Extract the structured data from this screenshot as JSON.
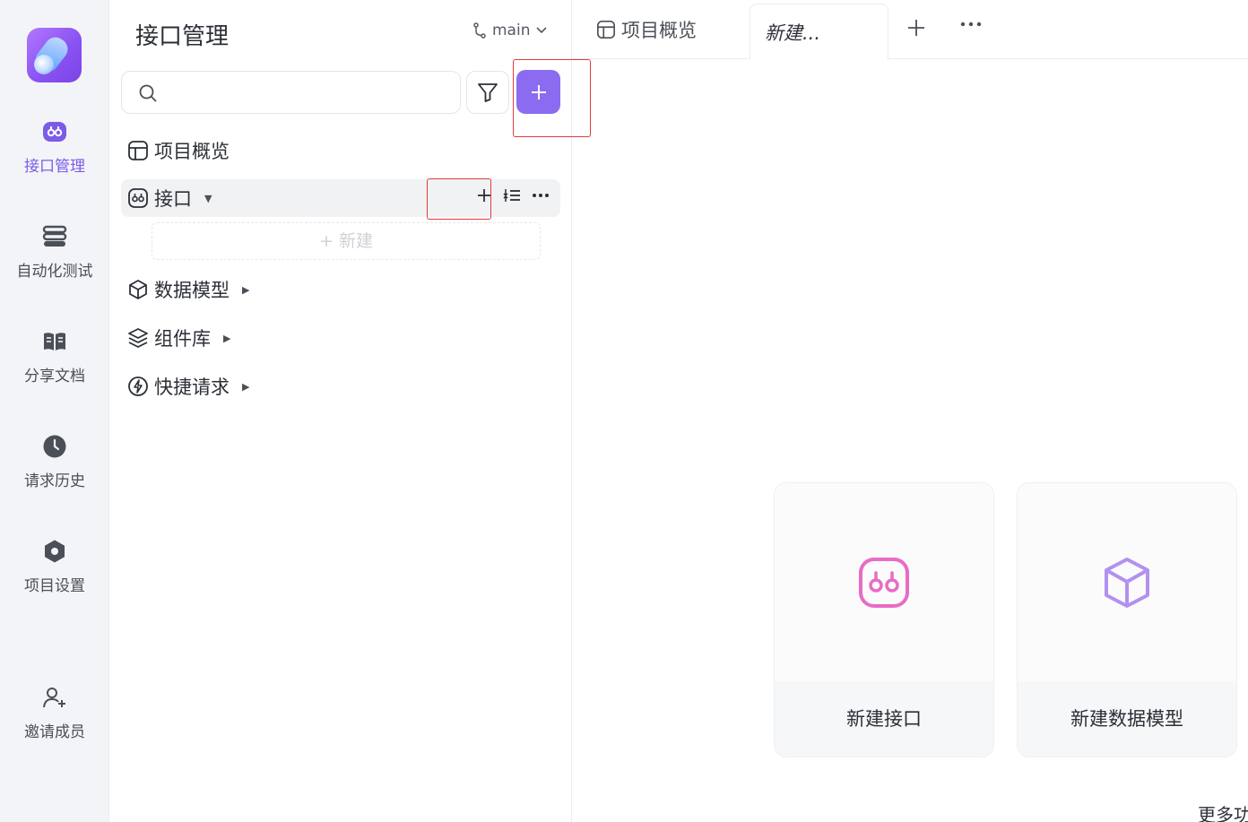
{
  "rail": {
    "items": [
      {
        "label": "接口管理",
        "icon": "api-icon",
        "active": true
      },
      {
        "label": "自动化测试",
        "icon": "automation-icon"
      },
      {
        "label": "分享文档",
        "icon": "book-icon"
      },
      {
        "label": "请求历史",
        "icon": "clock-icon"
      },
      {
        "label": "项目设置",
        "icon": "settings-icon"
      },
      {
        "label": "邀请成员",
        "icon": "add-user-icon"
      }
    ]
  },
  "panel": {
    "title": "接口管理",
    "branch": "main",
    "search_placeholder": "",
    "tree": [
      {
        "label": "项目概览",
        "icon": "overview-icon"
      },
      {
        "label": "接口",
        "icon": "api-icon"
      },
      {
        "label": "数据模型",
        "icon": "cube-icon"
      },
      {
        "label": "组件库",
        "icon": "layers-icon"
      },
      {
        "label": "快捷请求",
        "icon": "lightning-icon"
      }
    ],
    "new_placeholder": "+ 新建"
  },
  "tabs": {
    "items": [
      {
        "label": "项目概览"
      },
      {
        "label": "新建..."
      }
    ]
  },
  "cards": [
    {
      "label": "新建接口"
    },
    {
      "label": "新建数据模型"
    }
  ],
  "more_label": "更多功"
}
